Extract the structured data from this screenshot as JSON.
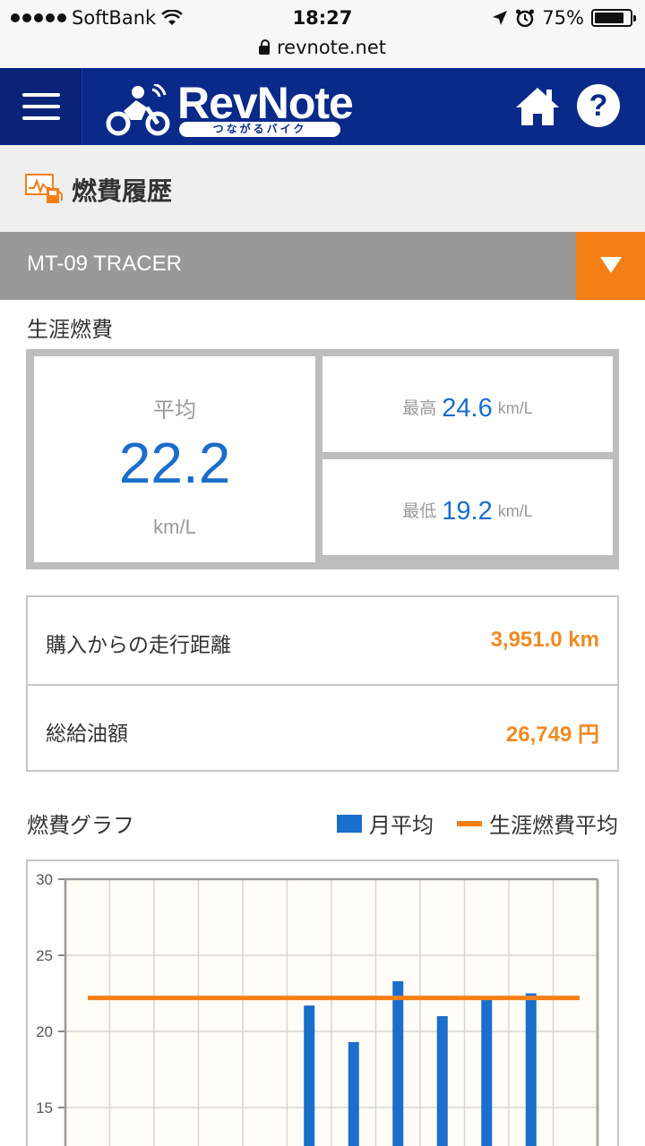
{
  "status_bar": {
    "carrier": "SoftBank",
    "time": "18:27",
    "battery": "75%",
    "url": "revnote.net"
  },
  "header": {
    "logo_text": "RevNote",
    "logo_tagline": "つながるバイク"
  },
  "page": {
    "title": "燃費履歴",
    "vehicle": "MT-09 TRACER"
  },
  "lifetime": {
    "label": "生涯燃費",
    "average_label": "平均",
    "average_value": "22.2",
    "unit": "km/L",
    "max_label": "最高",
    "max_value": "24.6",
    "min_label": "最低",
    "min_value": "19.2"
  },
  "stats": [
    {
      "label": "購入からの走行距離",
      "value": "3,951.0 km"
    },
    {
      "label": "総給油額",
      "value": "26,749",
      "suffix": "円"
    }
  ],
  "graph": {
    "label": "燃費グラフ",
    "legend_monthly": "月平均",
    "legend_lifetime": "生涯燃費平均"
  },
  "colors": {
    "header": "#0a2a8a",
    "accent_orange": "#f57f17",
    "value_blue": "#1a6ecc",
    "bar_blue": "#1a6ecc",
    "line_orange": "#f57f17"
  },
  "chart_data": {
    "type": "bar",
    "y_ticks": [
      "30",
      "25",
      "20",
      "15"
    ],
    "ylim": [
      0,
      30
    ],
    "grid": true,
    "x_slots": 12,
    "series": [
      {
        "values": [
          null,
          null,
          null,
          null,
          null,
          21.7,
          19.3,
          23.3,
          21.0,
          22.2,
          22.5,
          null
        ]
      }
    ],
    "reference_line": 22.2
  }
}
